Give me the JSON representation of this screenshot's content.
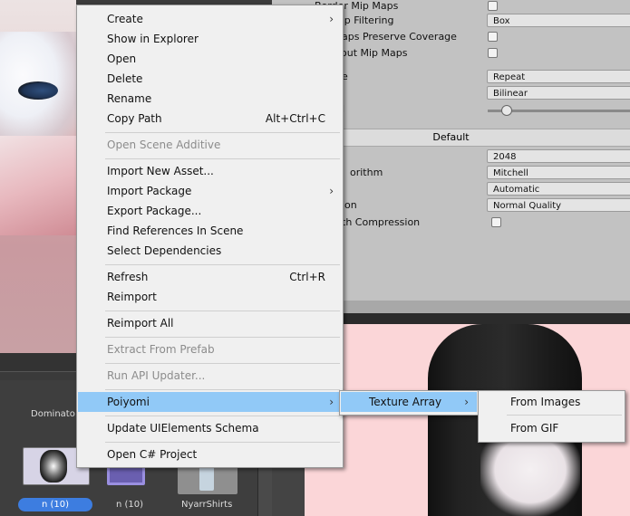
{
  "inspector": {
    "rows": [
      {
        "label": "Border Mip Maps",
        "control": "checkbox"
      },
      {
        "label": "ap Filtering",
        "control": "dropdown",
        "value": "Box"
      },
      {
        "label": "aps Preserve Coverage",
        "control": "checkbox"
      },
      {
        "label": "out Mip Maps",
        "control": "checkbox"
      },
      {
        "label": "e",
        "control": "dropdown",
        "value": "Repeat"
      },
      {
        "label": "",
        "control": "dropdown",
        "value": "Bilinear"
      },
      {
        "label": "l",
        "control": "slider"
      }
    ],
    "platform_tab": "Default",
    "platform_rows": [
      {
        "label": "",
        "value": "2048"
      },
      {
        "label": "orithm",
        "value": "Mitchell"
      },
      {
        "label": "",
        "value": "Automatic"
      },
      {
        "label": "ion",
        "value": "Normal Quality"
      },
      {
        "label": "th Compression",
        "control": "checkbox"
      }
    ]
  },
  "project": {
    "top_label": "Dominato",
    "assets": [
      {
        "label": "n (10)",
        "selected": true
      },
      {
        "label": "n (10)",
        "selected": false
      },
      {
        "label": "NyarrShirts",
        "selected": false
      }
    ]
  },
  "context_menu": {
    "items": [
      {
        "label": "Create",
        "submenu": true
      },
      {
        "label": "Show in Explorer"
      },
      {
        "label": "Open"
      },
      {
        "label": "Delete"
      },
      {
        "label": "Rename"
      },
      {
        "label": "Copy Path",
        "shortcut": "Alt+Ctrl+C"
      },
      {
        "separator": true
      },
      {
        "label": "Open Scene Additive",
        "disabled": true
      },
      {
        "separator": true
      },
      {
        "label": "Import New Asset..."
      },
      {
        "label": "Import Package",
        "submenu": true
      },
      {
        "label": "Export Package..."
      },
      {
        "label": "Find References In Scene"
      },
      {
        "label": "Select Dependencies"
      },
      {
        "separator": true
      },
      {
        "label": "Refresh",
        "shortcut": "Ctrl+R"
      },
      {
        "label": "Reimport"
      },
      {
        "separator": true
      },
      {
        "label": "Reimport All"
      },
      {
        "separator": true
      },
      {
        "label": "Extract From Prefab",
        "disabled": true
      },
      {
        "separator": true
      },
      {
        "label": "Run API Updater...",
        "disabled": true
      },
      {
        "separator": true
      },
      {
        "label": "Poiyomi",
        "submenu": true,
        "highlighted": true
      },
      {
        "separator": true
      },
      {
        "label": "Update UIElements Schema"
      },
      {
        "separator": true
      },
      {
        "label": "Open C# Project"
      }
    ],
    "submenu_arrow": "›"
  },
  "poiyomi_submenu": {
    "items": [
      {
        "label": "Texture Array",
        "submenu": true,
        "highlighted": true
      }
    ]
  },
  "texture_array_submenu": {
    "items": [
      {
        "label": "From Images"
      },
      {
        "label": "From GIF"
      }
    ]
  },
  "colors": {
    "menu_bg": "#f0f0f0",
    "menu_highlight": "#91c9f7",
    "disabled_text": "#8c8c8c",
    "selected_badge": "#3d7de0",
    "inspector_bg": "#c2c2c2",
    "preview_bg": "#fbd6d8"
  }
}
